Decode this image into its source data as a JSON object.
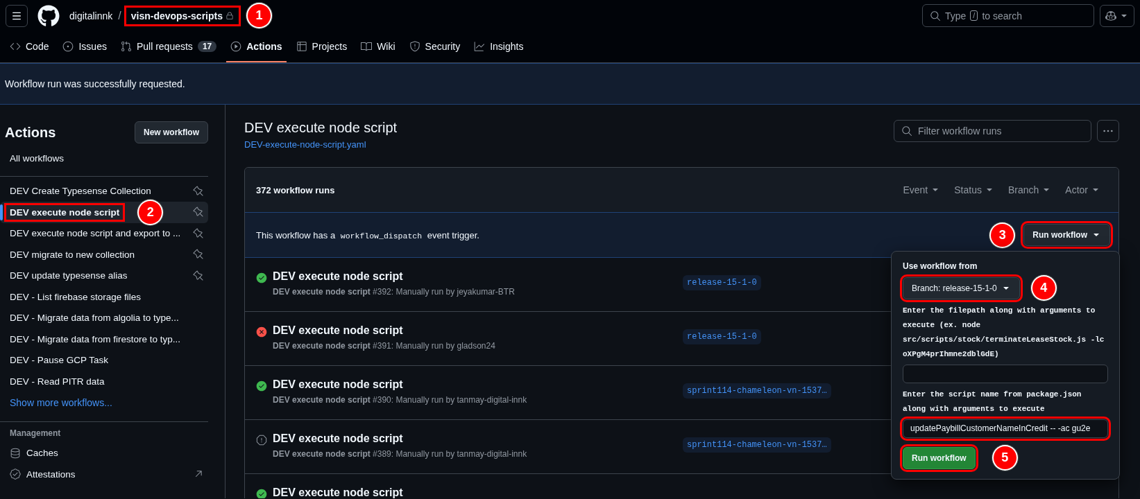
{
  "header": {
    "owner": "digitalinnk",
    "separator": "/",
    "repo": {
      "name": "visn-devops-scripts",
      "private": true,
      "highlighted": true,
      "callout": "1"
    },
    "search": {
      "before": "Type",
      "key": "/",
      "after": "to search"
    }
  },
  "tabs": [
    {
      "label": "Code",
      "selected": false
    },
    {
      "label": "Issues",
      "selected": false
    },
    {
      "label": "Pull requests",
      "count": "17",
      "selected": false
    },
    {
      "label": "Actions",
      "selected": true
    },
    {
      "label": "Projects",
      "selected": false
    },
    {
      "label": "Wiki",
      "selected": false
    },
    {
      "label": "Security",
      "selected": false
    },
    {
      "label": "Insights",
      "selected": false
    }
  ],
  "flash": "Workflow run was successfully requested.",
  "sidebar": {
    "title": "Actions",
    "new_button": "New workflow",
    "all": "All workflows",
    "workflows": [
      {
        "label": "DEV Create Typesense Collection",
        "pinned": true,
        "selected": false
      },
      {
        "label": "DEV execute node script",
        "pinned": true,
        "selected": true,
        "highlighted": true,
        "callout": "2"
      },
      {
        "label": "DEV execute node script and export to ...",
        "pinned": true,
        "selected": false
      },
      {
        "label": "DEV migrate to new collection",
        "pinned": true,
        "selected": false
      },
      {
        "label": "DEV update typesense alias",
        "pinned": true,
        "selected": false
      },
      {
        "label": "DEV - List firebase storage files",
        "pinned": false,
        "selected": false
      },
      {
        "label": "DEV - Migrate data from algolia to type...",
        "pinned": false,
        "selected": false
      },
      {
        "label": "DEV - Migrate data from firestore to typ...",
        "pinned": false,
        "selected": false
      },
      {
        "label": "DEV - Pause GCP Task",
        "pinned": false,
        "selected": false
      },
      {
        "label": "DEV - Read PITR data",
        "pinned": false,
        "selected": false
      }
    ],
    "show_more": "Show more workflows...",
    "section": "Management",
    "management": [
      {
        "label": "Caches",
        "external": false
      },
      {
        "label": "Attestations",
        "external": true
      }
    ]
  },
  "main": {
    "title": "DEV execute node script",
    "file": "DEV-execute-node-script.yaml",
    "filter": {
      "placeholder": "Filter workflow runs"
    },
    "runs_count": "372 workflow runs",
    "filters": [
      "Event",
      "Status",
      "Branch",
      "Actor"
    ],
    "dispatch": {
      "before": "This workflow has a",
      "code": "workflow_dispatch",
      "after": "event trigger."
    },
    "run_button": {
      "label": "Run workflow",
      "highlighted": true,
      "callout": "3"
    },
    "runs": [
      {
        "kind": "success",
        "title": "DEV execute node script",
        "subtitle": "**DEV execute node script** #392: Manually run by jeyakumar-BTR",
        "branch": "release-15-1-0"
      },
      {
        "kind": "failure",
        "title": "DEV execute node script",
        "subtitle": "**DEV execute node script** #391: Manually run by gladson24",
        "branch": "release-15-1-0"
      },
      {
        "kind": "success",
        "title": "DEV execute node script",
        "subtitle": "**DEV execute node script** #390: Manually run by tanmay-digital-innk",
        "branch": "sprint114-chameleon-vn-1537…"
      },
      {
        "kind": "neutral",
        "title": "DEV execute node script",
        "subtitle": "**DEV execute node script** #389: Manually run by tanmay-digital-innk",
        "branch": "sprint114-chameleon-vn-1537…"
      },
      {
        "kind": "success",
        "title": "DEV execute node script"
      }
    ]
  },
  "popup": {
    "label": "Use workflow from",
    "branch": {
      "label": "Branch: release-15-1-0",
      "highlighted": true,
      "callout": "4"
    },
    "inputs": [
      {
        "label": "Enter the filepath along with arguments to execute (ex. node src/scripts/stock/terminateLeaseStock.js -lc oXPgM4prIhmne2dblGdE)"
      },
      {
        "label": "Enter the script name from package.json along with arguments to execute",
        "value": "updatePaybillCustomerNameInCredit -- -ac gu2e",
        "highlighted": true
      }
    ],
    "submit": {
      "label": "Run workflow",
      "highlighted": true,
      "callout": "5"
    }
  }
}
